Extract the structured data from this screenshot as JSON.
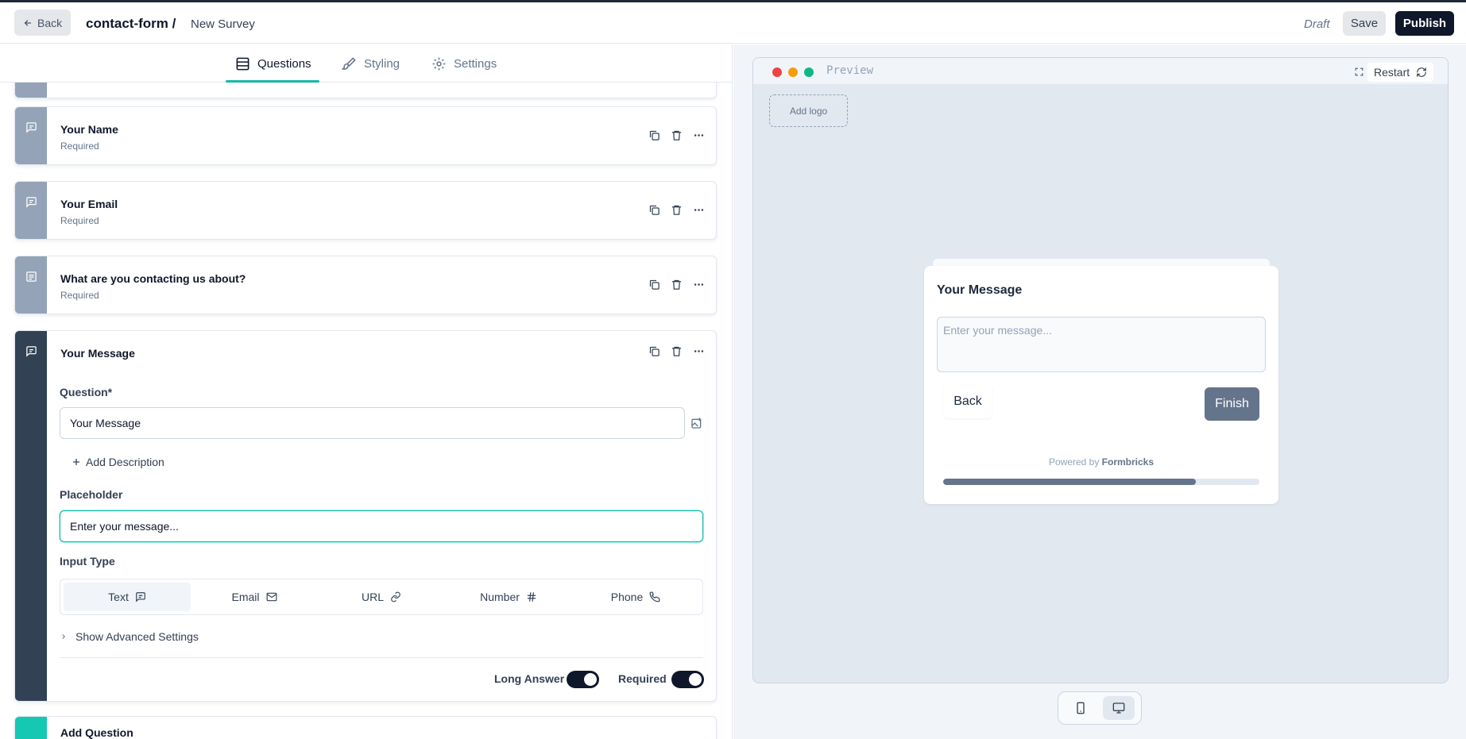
{
  "topbar": {
    "back_label": "Back",
    "environment": "contact-form /",
    "survey_name": "New Survey",
    "status": "Draft",
    "save_label": "Save",
    "publish_label": "Publish"
  },
  "tabs": [
    {
      "label": "Questions",
      "icon": "rows-icon",
      "active": true
    },
    {
      "label": "Styling",
      "icon": "paintbrush-icon",
      "active": false
    },
    {
      "label": "Settings",
      "icon": "gear-icon",
      "active": false
    }
  ],
  "questions": [
    {
      "title": "Your Name",
      "subtitle": "Required",
      "icon": "message-square-icon"
    },
    {
      "title": "Your Email",
      "subtitle": "Required",
      "icon": "message-square-icon"
    },
    {
      "title": "What are you contacting us about?",
      "subtitle": "Required",
      "icon": "list-icon"
    }
  ],
  "active_question": {
    "title": "Your Message",
    "question_label": "Question*",
    "question_value": "Your Message",
    "add_description": "Add Description",
    "placeholder_label": "Placeholder",
    "placeholder_value": "Enter your message...",
    "input_type_label": "Input Type",
    "input_types": [
      {
        "label": "Text",
        "icon": "message-square-icon",
        "active": true
      },
      {
        "label": "Email",
        "icon": "mail-icon",
        "active": false
      },
      {
        "label": "URL",
        "icon": "link-icon",
        "active": false
      },
      {
        "label": "Number",
        "icon": "hash-icon",
        "active": false
      },
      {
        "label": "Phone",
        "icon": "phone-icon",
        "active": false
      }
    ],
    "advanced_settings": "Show Advanced Settings",
    "long_answer_label": "Long Answer",
    "long_answer_on": true,
    "required_label": "Required",
    "required_on": true
  },
  "add_question_label": "Add Question",
  "preview": {
    "label": "Preview",
    "restart_label": "Restart",
    "add_logo_label": "Add logo",
    "question_title": "Your Message",
    "textarea_placeholder": "Enter your message...",
    "back_label": "Back",
    "finish_label": "Finish",
    "powered_by": "Powered by",
    "powered_brand": "Formbricks",
    "progress": 0.8,
    "window_dots": [
      "#ef4444",
      "#f59e0b",
      "#10b981"
    ]
  },
  "colors": {
    "accent": "#14b8a6",
    "primary": "#0f172a",
    "strip_inactive": "#94a3b8",
    "strip_active": "#334155"
  }
}
